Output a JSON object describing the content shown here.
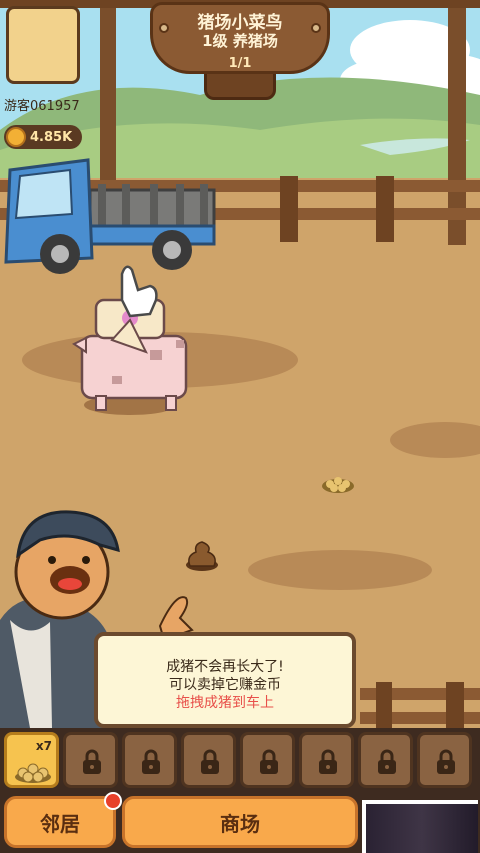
{
  "player": {
    "name": "游客061957",
    "coins": "4.85K"
  },
  "sign": {
    "title": "猪场小菜鸟",
    "subtitle": "1级 养猪场",
    "progress": "1/1"
  },
  "dialog": {
    "line1": "成猪不会再长大了!",
    "line2": "可以卖掉它赚金币",
    "line3": "拖拽成猪到车上",
    "highlight_color": "#e8504a"
  },
  "inventory": {
    "first_slot_count": "x7",
    "first_slot_icon": "feed-pile-icon",
    "locked_slot_icon": "padlock-icon"
  },
  "buttons": {
    "neighbors_label": "邻居",
    "shop_label": "商场"
  },
  "colors": {
    "ground": "#cfa46a",
    "fence": "#7a4e2b",
    "button": "#f9a94b",
    "panel": "#3e2b20"
  }
}
